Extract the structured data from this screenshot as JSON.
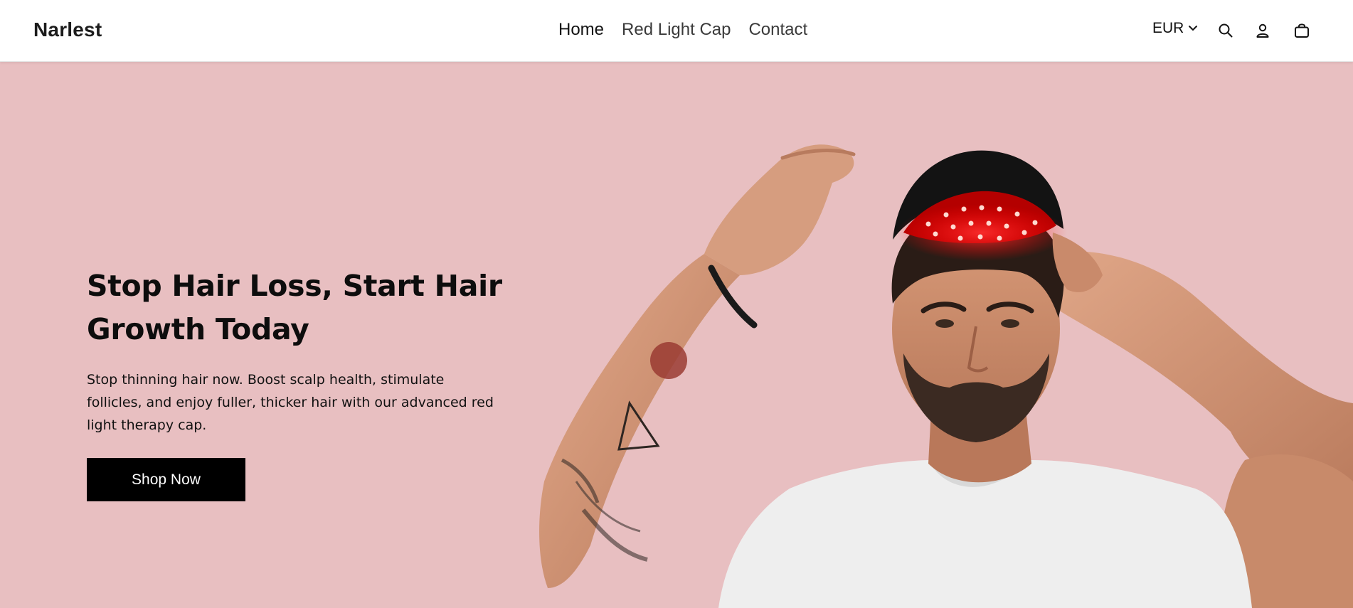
{
  "brand": {
    "name": "Narlest"
  },
  "nav": {
    "items": [
      {
        "label": "Home"
      },
      {
        "label": "Red Light Cap"
      },
      {
        "label": "Contact"
      }
    ]
  },
  "header_tools": {
    "currency": "EUR",
    "icons": [
      "chevron-down-icon",
      "search-icon",
      "account-icon",
      "cart-icon"
    ]
  },
  "hero": {
    "title": "Stop Hair Loss, Start Hair Growth Today",
    "text": "Stop thinning hair now. Boost scalp health, stimulate follicles, and enjoy fuller, thicker hair with our advanced red light therapy cap.",
    "button_label": "Shop Now",
    "image_alt": "man-wearing-red-light-cap-photo"
  },
  "colors": {
    "hero_background": "#e8bfc1",
    "button_background": "#000000",
    "button_text": "#ffffff",
    "header_background": "#ffffff",
    "cap_led": "#ff2a2a"
  }
}
